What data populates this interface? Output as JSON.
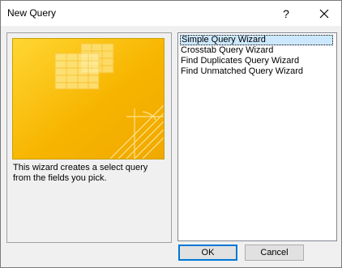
{
  "window": {
    "title": "New Query",
    "help_label": "?"
  },
  "description": {
    "line1": "This wizard creates a select query",
    "line2": "from the fields you pick."
  },
  "wizards": {
    "items": [
      {
        "label": "Simple Query Wizard",
        "selected": true
      },
      {
        "label": "Crosstab Query Wizard",
        "selected": false
      },
      {
        "label": "Find Duplicates Query Wizard",
        "selected": false
      },
      {
        "label": "Find Unmatched Query Wizard",
        "selected": false
      }
    ]
  },
  "buttons": {
    "ok_label": "OK",
    "cancel_label": "Cancel"
  },
  "colors": {
    "preview_background": "#f7b500",
    "selection": "#cce8ff",
    "default_button_border": "#0078d7"
  },
  "icons": {
    "close": "close-icon",
    "preview": "select-query-preview-illustration"
  }
}
